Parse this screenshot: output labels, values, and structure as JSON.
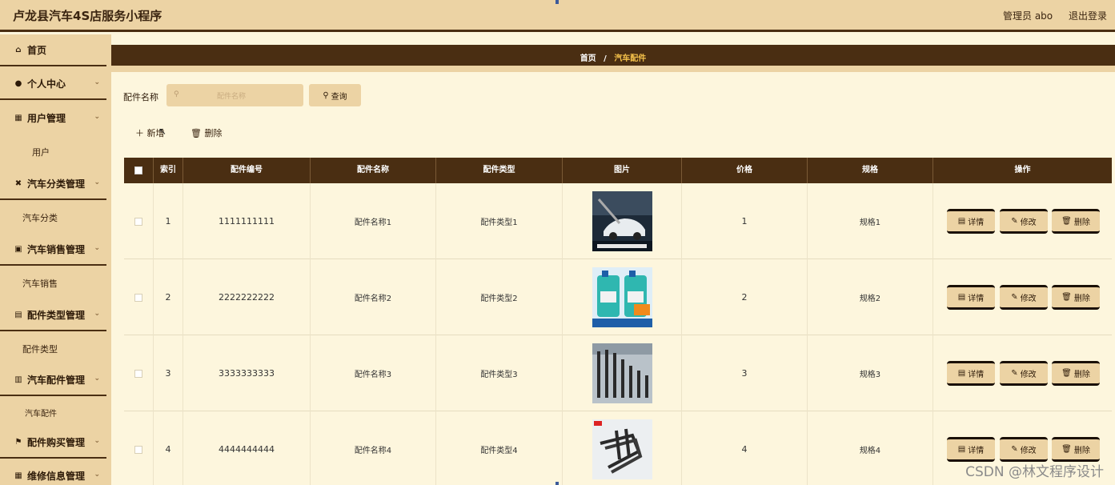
{
  "header": {
    "title": "卢龙县汽车4S店服务小程序",
    "user_label": "管理员 abo",
    "logout_label": "退出登录"
  },
  "sidebar": {
    "items": [
      {
        "label": "首页",
        "icon": "home-icon",
        "glyph": "⌂"
      },
      {
        "label": "个人中心",
        "icon": "person-icon",
        "glyph": "●",
        "chevron": "⌄"
      },
      {
        "label": "用户管理",
        "icon": "grid-icon",
        "glyph": "▦",
        "chevron": "⌄"
      },
      {
        "label": "汽车分类管理",
        "icon": "car-icon",
        "glyph": "✖",
        "chevron": "⌄"
      },
      {
        "label": "汽车销售管理",
        "icon": "clipboard-icon",
        "glyph": "▣",
        "chevron": "⌄"
      },
      {
        "label": "配件类型管理",
        "icon": "file-icon",
        "glyph": "▤",
        "chevron": "⌄"
      },
      {
        "label": "汽车配件管理",
        "icon": "bar-icon",
        "glyph": "▥",
        "chevron": "⌄"
      },
      {
        "label": "配件购买管理",
        "icon": "flag-icon",
        "glyph": "⚑",
        "chevron": "⌄"
      },
      {
        "label": "维修信息管理",
        "icon": "grid-icon",
        "glyph": "▦",
        "chevron": "⌄"
      }
    ],
    "subs": [
      "用户",
      "汽车分类",
      "汽车销售",
      "配件类型",
      "汽车配件"
    ]
  },
  "breadcrumb": {
    "home": "首页",
    "sep": "/",
    "current": "汽车配件"
  },
  "search": {
    "label": "配件名称",
    "placeholder": "配件名称",
    "button": "查询"
  },
  "actions": {
    "add": "新增",
    "delete": "删除"
  },
  "table": {
    "columns": [
      "索引",
      "配件编号",
      "配件名称",
      "配件类型",
      "图片",
      "价格",
      "规格",
      "操作"
    ],
    "rows": [
      {
        "index": "1",
        "code": "1111111111",
        "name": "配件名称1",
        "type": "配件类型1",
        "price": "1",
        "spec": "规格1",
        "image": "wiper-blade-car"
      },
      {
        "index": "2",
        "code": "2222222222",
        "name": "配件名称2",
        "type": "配件类型2",
        "price": "2",
        "spec": "规格2",
        "image": "windshield-fluid-bottles"
      },
      {
        "index": "3",
        "code": "3333333333",
        "name": "配件名称3",
        "type": "配件类型3",
        "price": "3",
        "spec": "规格3",
        "image": "spark-plug-tools"
      },
      {
        "index": "4",
        "code": "4444444444",
        "name": "配件名称4",
        "type": "配件类型4",
        "price": "4",
        "spec": "规格4",
        "image": "hook-bracket-parts"
      }
    ],
    "ops": {
      "detail": "详情",
      "edit": "修改",
      "delete": "删除"
    }
  },
  "watermark": "CSDN @林文程序设计",
  "colors": {
    "brown": "#4a2e12",
    "tan": "#ecd3a4",
    "cream": "#fdf6dd",
    "accent": "#f3c04a"
  }
}
